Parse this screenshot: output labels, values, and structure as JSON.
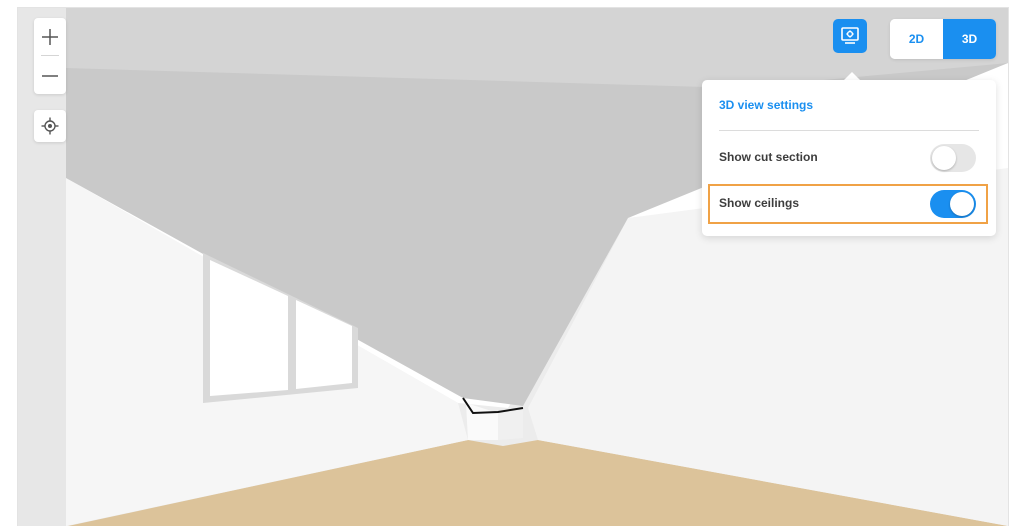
{
  "view_toggle": {
    "options": [
      "2D",
      "3D"
    ],
    "selected": "3D"
  },
  "settings_panel": {
    "title": "3D view settings",
    "rows": [
      {
        "label": "Show cut section",
        "enabled": false
      },
      {
        "label": "Show ceilings",
        "enabled": true
      }
    ]
  },
  "icons": {
    "zoom_in": "plus-icon",
    "zoom_out": "minus-icon",
    "locate": "crosshair-icon",
    "settings": "monitor-gear-icon"
  },
  "colors": {
    "accent": "#1a8ff0",
    "highlight": "#f0a246",
    "floor": "#dcc39a",
    "ceiling": "#c9c9c9"
  }
}
